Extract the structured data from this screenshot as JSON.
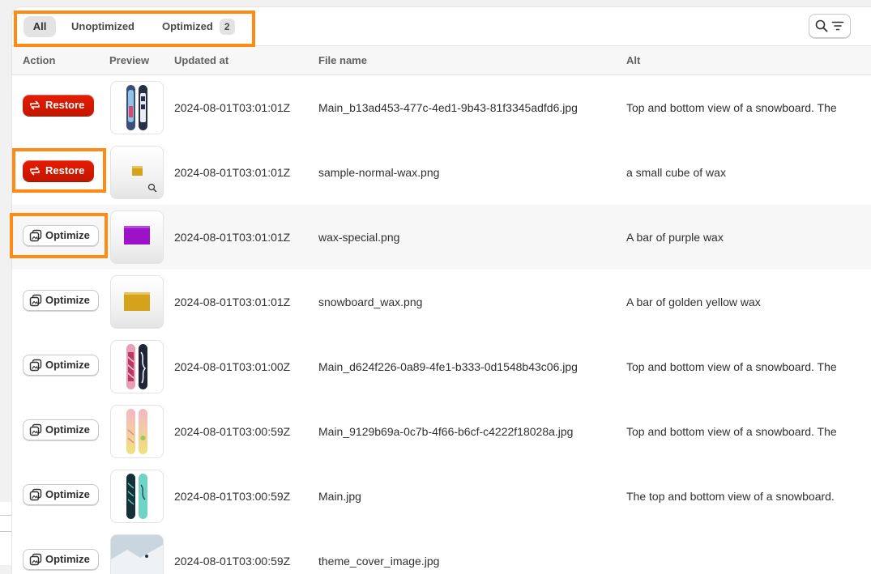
{
  "tabs": {
    "all": "All",
    "unoptimized": "Unoptimized",
    "optimized": "Optimized",
    "optimized_count": "2"
  },
  "toolbar": {
    "search_icon": "search-icon",
    "filter_icon": "filter-icon"
  },
  "columns": {
    "action": "Action",
    "preview": "Preview",
    "updated_at": "Updated at",
    "file_name": "File name",
    "alt": "Alt"
  },
  "rows": [
    {
      "action": "Restore",
      "updated_at": "2024-08-01T03:01:01Z",
      "file_name": "Main_b13ad453-477c-4ed1-9b43-81f3345adfd6.jpg",
      "alt": "Top and bottom view of a snowboard. The"
    },
    {
      "action": "Restore",
      "updated_at": "2024-08-01T03:01:01Z",
      "file_name": "sample-normal-wax.png",
      "alt": "a small cube of wax"
    },
    {
      "action": "Optimize",
      "updated_at": "2024-08-01T03:01:01Z",
      "file_name": "wax-special.png",
      "alt": "A bar of purple wax"
    },
    {
      "action": "Optimize",
      "updated_at": "2024-08-01T03:01:01Z",
      "file_name": "snowboard_wax.png",
      "alt": "A bar of golden yellow wax"
    },
    {
      "action": "Optimize",
      "updated_at": "2024-08-01T03:01:00Z",
      "file_name": "Main_d624f226-0a89-4fe1-b333-0d1548b43c06.jpg",
      "alt": "Top and bottom view of a snowboard. The"
    },
    {
      "action": "Optimize",
      "updated_at": "2024-08-01T03:00:59Z",
      "file_name": "Main_9129b69a-0c7b-4f66-b6cf-c4222f18028a.jpg",
      "alt": "Top and bottom view of a snowboard. The"
    },
    {
      "action": "Optimize",
      "updated_at": "2024-08-01T03:00:59Z",
      "file_name": "Main.jpg",
      "alt": "The top and bottom view of a snowboard."
    },
    {
      "action": "Optimize",
      "updated_at": "2024-08-01T03:00:59Z",
      "file_name": "theme_cover_image.jpg",
      "alt": ""
    }
  ],
  "colors": {
    "restore": "#e51c00",
    "highlight": "#ff8a14",
    "wax_purple": "#9b12c9",
    "wax_gold": "#d6a21c"
  }
}
